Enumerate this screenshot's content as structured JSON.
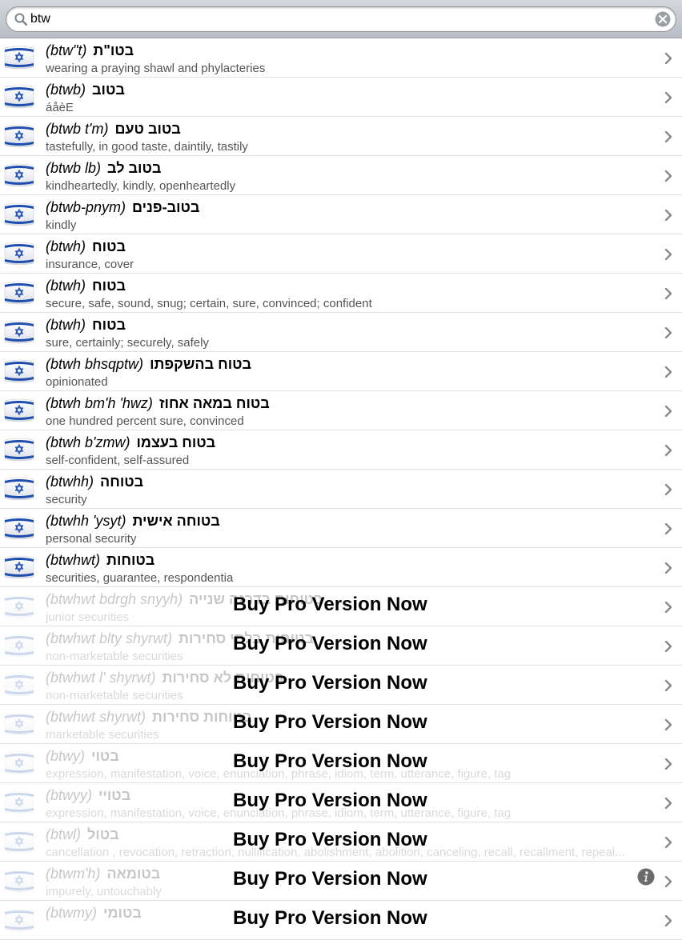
{
  "search": {
    "value": "btw",
    "placeholder": ""
  },
  "promo_label": "Buy Pro Version Now",
  "entries": [
    {
      "translit": "(btw\"t)",
      "hebrew": "בטו\"ת",
      "meaning": "wearing a praying shawl and phylacteries",
      "locked": false
    },
    {
      "translit": "(btwb)",
      "hebrew": "בטוב",
      "meaning": "áåèE",
      "locked": false
    },
    {
      "translit": "(btwb t'm)",
      "hebrew": "בטוב טעם",
      "meaning": "tastefully, in good taste, daintily, tastily",
      "locked": false
    },
    {
      "translit": "(btwb lb)",
      "hebrew": "בטוב לב",
      "meaning": "kindheartedly, kindly, openheartedly",
      "locked": false
    },
    {
      "translit": "(btwb-pnym)",
      "hebrew": "בטוב-פנים",
      "meaning": "kindly",
      "locked": false
    },
    {
      "translit": "(btwh)",
      "hebrew": "בטוח",
      "meaning": "insurance, cover",
      "locked": false
    },
    {
      "translit": "(btwh)",
      "hebrew": "בטוח",
      "meaning": "secure, safe, sound, snug; certain, sure, convinced; confident",
      "locked": false
    },
    {
      "translit": "(btwh)",
      "hebrew": "בטוח",
      "meaning": "sure, certainly; securely, safely",
      "locked": false
    },
    {
      "translit": "(btwh bhsqptw)",
      "hebrew": "בטוח בהשקפתו",
      "meaning": "opinionated",
      "locked": false
    },
    {
      "translit": "(btwh bm'h 'hwz)",
      "hebrew": "בטוח במאה אחוז",
      "meaning": "one hundred percent sure, convinced",
      "locked": false
    },
    {
      "translit": "(btwh b'zmw)",
      "hebrew": "בטוח בעצמו",
      "meaning": "self-confident, self-assured",
      "locked": false
    },
    {
      "translit": "(btwhh)",
      "hebrew": "בטוחה",
      "meaning": "security",
      "locked": false
    },
    {
      "translit": "(btwhh 'ysyt)",
      "hebrew": "בטוחה אישית",
      "meaning": "personal security",
      "locked": false
    },
    {
      "translit": "(btwhwt)",
      "hebrew": "בטוחות",
      "meaning": "securities, guarantee, respondentia",
      "locked": false
    },
    {
      "translit": "(btwhwt bdrgh snyyh)",
      "hebrew": "בטוחות בדרגה שנייה",
      "meaning": "junior securities",
      "locked": true
    },
    {
      "translit": "(btwhwt blty shyrwt)",
      "hebrew": "בטוחות בלתי סחירות",
      "meaning": "non-marketable securities",
      "locked": true
    },
    {
      "translit": "(btwhwt l' shyrwt)",
      "hebrew": "בטוחות לא סחירות",
      "meaning": "non-marketable securities",
      "locked": true
    },
    {
      "translit": "(btwhwt shyrwt)",
      "hebrew": "בטוחות סחירות",
      "meaning": "marketable securities",
      "locked": true
    },
    {
      "translit": "(btwy)",
      "hebrew": "בטוי",
      "meaning": "expression, manifestation, voice, enunciation, phrase, idiom, term, utterance, figure, tag",
      "locked": true
    },
    {
      "translit": "(btwyy)",
      "hebrew": "בטויי",
      "meaning": "expression, manifestation, voice, enunciation, phrase, idiom, term, utterance, figure, tag",
      "locked": true
    },
    {
      "translit": "(btwl)",
      "hebrew": "בטול",
      "meaning": "cancellation , revocation, retraction, nullification, abolishment, abolition, canceling, recall, recallment, repeal...",
      "locked": true
    },
    {
      "translit": "(btwm'h)",
      "hebrew": "בטומאה",
      "meaning": "impurely, untouchably",
      "locked": true,
      "info": true
    },
    {
      "translit": "(btwmy)",
      "hebrew": "בטומי",
      "meaning": "",
      "locked": true
    }
  ],
  "icons": {
    "flag": "israel-flag-icon",
    "chevron": "chevron-right-icon",
    "search": "search-icon",
    "clear": "clear-icon",
    "info": "info-icon"
  },
  "colors": {
    "flag_blue": "#1f4fae",
    "chevron": "#8a8a8a"
  }
}
